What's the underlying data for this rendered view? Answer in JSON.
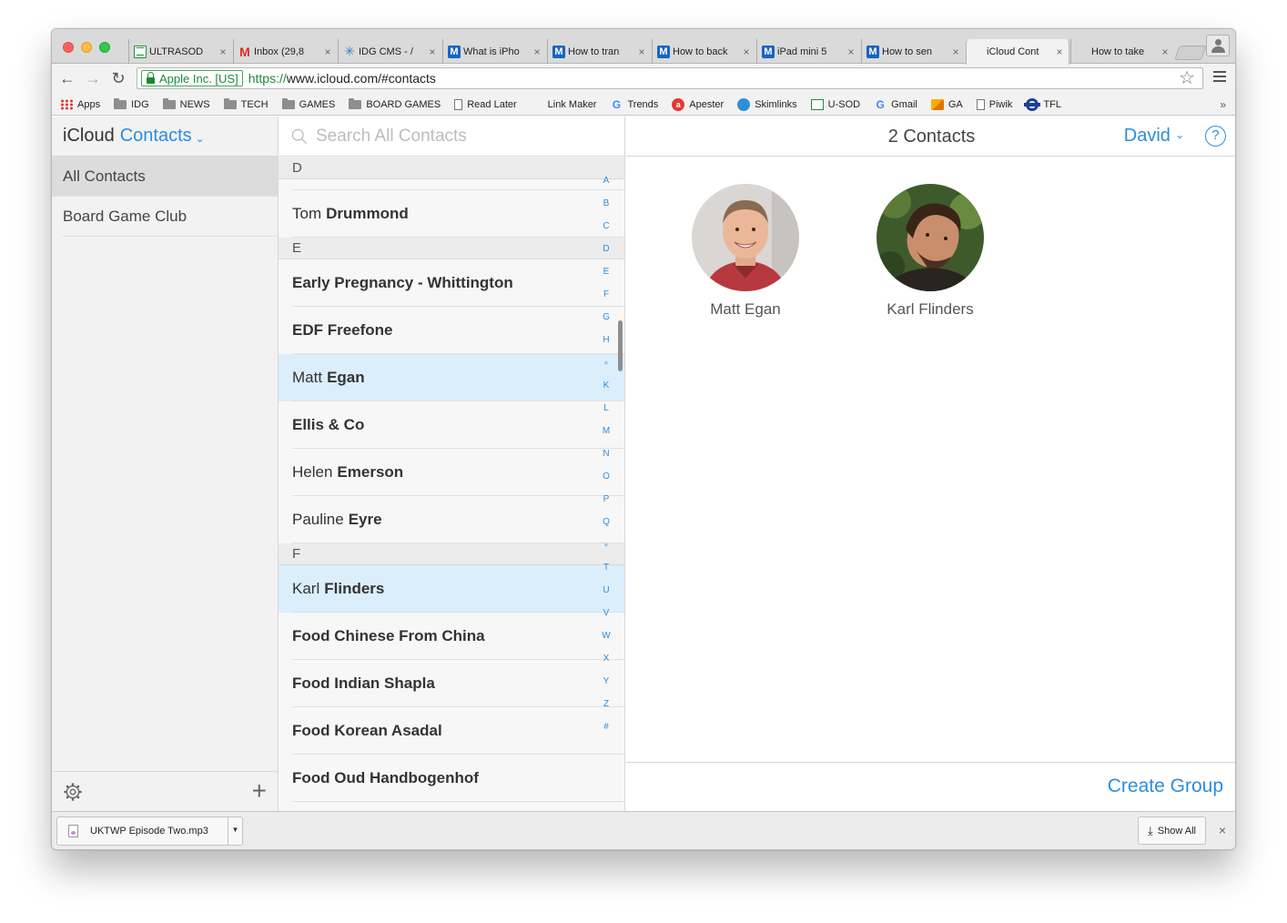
{
  "browser": {
    "tabs": [
      {
        "title": "ULTRASOD",
        "icon": "sheets-icon"
      },
      {
        "title": "Inbox (29,8",
        "icon": "gmail-icon"
      },
      {
        "title": "IDG CMS - /",
        "icon": "idg-icon"
      },
      {
        "title": "What is iPho",
        "icon": "m-icon"
      },
      {
        "title": "How to tran",
        "icon": "m-icon"
      },
      {
        "title": "How to back",
        "icon": "m-icon"
      },
      {
        "title": "iPad mini 5",
        "icon": "m-icon"
      },
      {
        "title": "How to sen",
        "icon": "m-icon"
      },
      {
        "title": "iCloud Cont",
        "icon": "apple-icon",
        "active": true
      },
      {
        "title": "How to take",
        "icon": "apple-icon"
      }
    ],
    "close_glyph": "×",
    "ev_label": "Apple Inc. [US]",
    "url_scheme": "https://",
    "url_rest": "www.icloud.com/#contacts",
    "bookmarks": [
      {
        "label": "Apps",
        "icon": "apps-icon"
      },
      {
        "label": "IDG",
        "icon": "folder-icon"
      },
      {
        "label": "NEWS",
        "icon": "folder-icon"
      },
      {
        "label": "TECH",
        "icon": "folder-icon"
      },
      {
        "label": "GAMES",
        "icon": "folder-icon"
      },
      {
        "label": "BOARD GAMES",
        "icon": "folder-icon"
      },
      {
        "label": "Read Later",
        "icon": "page-icon"
      },
      {
        "label": "Link Maker",
        "icon": "apple-icon"
      },
      {
        "label": "Trends",
        "icon": "google-icon"
      },
      {
        "label": "Apester",
        "icon": "apester-icon"
      },
      {
        "label": "Skimlinks",
        "icon": "skimlinks-icon"
      },
      {
        "label": "U-SOD",
        "icon": "sheets-icon"
      },
      {
        "label": "Gmail",
        "icon": "google-icon"
      },
      {
        "label": "GA",
        "icon": "analytics-icon"
      },
      {
        "label": "Piwik",
        "icon": "page-icon"
      },
      {
        "label": "TFL",
        "icon": "tfl-icon"
      }
    ],
    "bookmarks_more": "»"
  },
  "sidebar": {
    "brand": "iCloud",
    "section": "Contacts",
    "items": [
      "All Contacts",
      "Board Game Club"
    ]
  },
  "list": {
    "search_placeholder": "Search All Contacts",
    "groups": [
      {
        "letter": "D",
        "contacts": [
          {
            "first": "Tom",
            "last": "Drummond",
            "selected": false
          }
        ]
      },
      {
        "letter": "E",
        "contacts": [
          {
            "first": "",
            "last": "Early Pregnancy - Whittington",
            "selected": false
          },
          {
            "first": "",
            "last": "EDF Freefone",
            "selected": false
          },
          {
            "first": "Matt",
            "last": "Egan",
            "selected": true
          },
          {
            "first": "",
            "last": "Ellis & Co",
            "selected": false
          },
          {
            "first": "Helen",
            "last": "Emerson",
            "selected": false
          },
          {
            "first": "Pauline",
            "last": "Eyre",
            "selected": false
          }
        ]
      },
      {
        "letter": "F",
        "contacts": [
          {
            "first": "Karl",
            "last": "Flinders",
            "selected": true
          },
          {
            "first": "",
            "last": "Food Chinese From China",
            "selected": false
          },
          {
            "first": "",
            "last": "Food Indian Shapla",
            "selected": false
          },
          {
            "first": "",
            "last": "Food Korean Asadal",
            "selected": false
          },
          {
            "first": "",
            "last": "Food Oud Handbogenhof",
            "selected": false
          }
        ]
      }
    ],
    "index_letters": [
      "A",
      "B",
      "C",
      "D",
      "E",
      "F",
      "G",
      "H",
      "•",
      "K",
      "L",
      "M",
      "N",
      "O",
      "P",
      "Q",
      "•",
      "T",
      "U",
      "V",
      "W",
      "X",
      "Y",
      "Z",
      "#"
    ]
  },
  "detail": {
    "title": "2 Contacts",
    "user": "David",
    "help": "?",
    "cards": [
      {
        "name": "Matt Egan"
      },
      {
        "name": "Karl Flinders"
      }
    ],
    "create_group": "Create Group"
  },
  "downloads": {
    "file": "UKTWP Episode Two.mp3",
    "show_all": "Show All"
  }
}
